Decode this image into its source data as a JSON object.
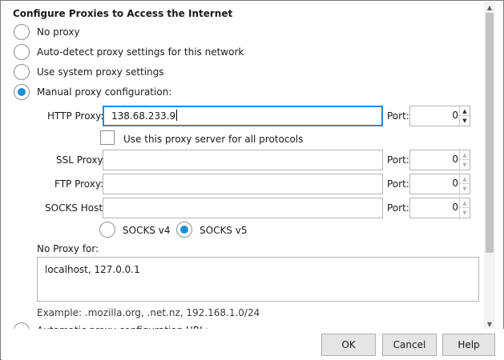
{
  "dialog": {
    "heading": "Configure Proxies to Access the Internet"
  },
  "proxy_options": {
    "no_proxy": "No proxy",
    "auto_detect": "Auto-detect proxy settings for this network",
    "system": "Use system proxy settings",
    "manual": "Manual proxy configuration:",
    "automatic_url": "Automatic proxy configuration URL:"
  },
  "manual": {
    "http_label": "HTTP Proxy:",
    "http_value": "138.68.233.9",
    "use_for_all_label": "Use this proxy server for all protocols",
    "ssl_label": "SSL Proxy:",
    "ssl_value": "",
    "ftp_label": "FTP Proxy:",
    "ftp_value": "",
    "socks_label": "SOCKS Host:",
    "socks_value": "",
    "port_label": "Port:",
    "http_port": "0",
    "ssl_port": "0",
    "ftp_port": "0",
    "socks_port": "0",
    "socks_v4": "SOCKS v4",
    "socks_v5": "SOCKS v5"
  },
  "no_proxy": {
    "label": "No Proxy for:",
    "value": "localhost, 127.0.0.1",
    "example": "Example: .mozilla.org, .net.nz, 192.168.1.0/24"
  },
  "buttons": {
    "ok": "OK",
    "cancel": "Cancel",
    "help": "Help"
  },
  "icons": {
    "close": "close-icon",
    "scroll_up": "scroll-up-icon",
    "scroll_down": "scroll-down-icon",
    "spin_up": "spin-up-icon",
    "spin_down": "spin-down-icon"
  },
  "colors": {
    "accent": "#1f8fd6",
    "focus_border": "#2a86d4"
  }
}
